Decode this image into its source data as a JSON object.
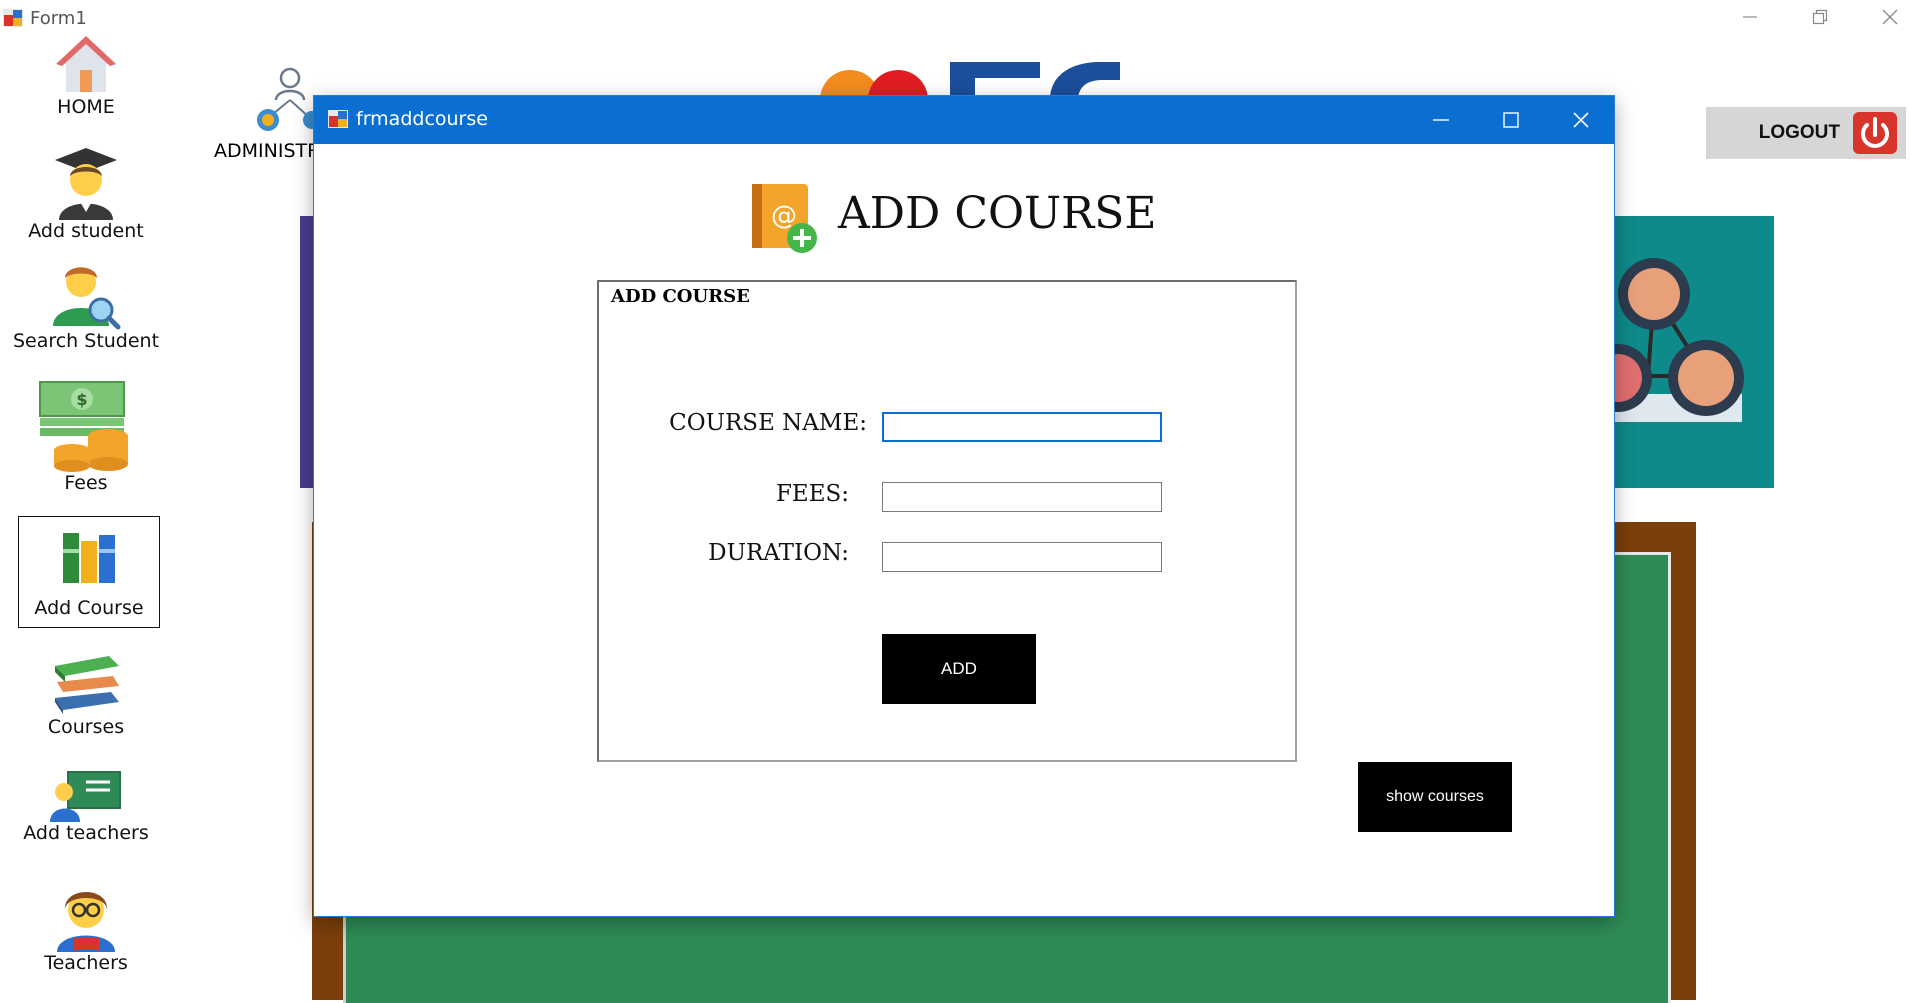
{
  "main_window": {
    "title": "Form1",
    "minimize_label": "—",
    "restore_label": "❐",
    "close_label": "✕"
  },
  "sidebar": {
    "items": [
      {
        "label": "HOME",
        "icon": "home-icon"
      },
      {
        "label": "Add student",
        "icon": "student-icon"
      },
      {
        "label": "Search Student",
        "icon": "search-student-icon"
      },
      {
        "label": "Fees",
        "icon": "money-icon"
      },
      {
        "label": "Add Course",
        "icon": "books-icon",
        "selected": true
      },
      {
        "label": "Courses",
        "icon": "stacked-books-icon"
      },
      {
        "label": "Add teachers",
        "icon": "teacher-board-icon"
      },
      {
        "label": "Teachers",
        "icon": "teacher-icon"
      }
    ]
  },
  "header": {
    "admin_label": "ADMINISTR",
    "logout_label": "LOGOUT"
  },
  "dialog": {
    "title": "frmaddcourse",
    "heading": "ADD COURSE",
    "group_legend": "ADD COURSE",
    "fields": {
      "course_name_label": "COURSE NAME:",
      "course_name_value": "",
      "fees_label": "FEES:",
      "fees_value": "",
      "duration_label": "DURATION:",
      "duration_value": ""
    },
    "add_button": "ADD",
    "show_courses_button": "show courses"
  },
  "colors": {
    "titlebar": "#0a6fd0",
    "board": "#2e8b57",
    "board_frame": "#7a3f0b",
    "teal_panel": "#0e8a8a",
    "button_black": "#000000",
    "logout_red": "#d9342b"
  }
}
